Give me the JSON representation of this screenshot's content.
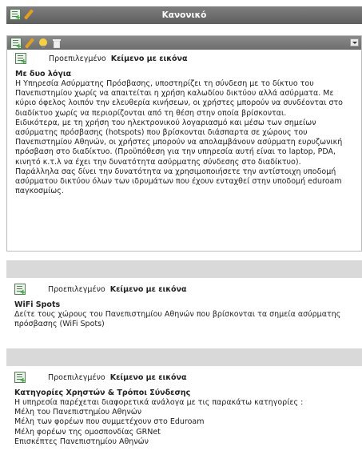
{
  "page": {
    "title": "Κανονικό"
  },
  "blocks": [
    {
      "default_label": "Προεπιλεγμένο",
      "type_name": "Κείμενο με εικόνα",
      "heading": "Με δυο λόγια",
      "paragraphs": [
        "Η Υπηρεσία Ασύρματης Πρόσβασης, υποστηρίζει τη σύνδεση με το δίκτυο του Πανεπιστημίου χωρίς να απαιτείται η χρήση καλωδίου δικτύου αλλά ασύρματα. Με κύριο όφελος λοιπόν την ελευθερία κινήσεων, οι χρήστες μπορούν να συνδέονται στο διαδίκτυο χωρίς να περιορίζονται από τη θέση στην οποία βρίσκονται.",
        "Ειδικότερα, με τη χρήση του ηλεκτρονικού λογαριασμό και μέσω των σημείων ασύρματης πρόσβασης (hotspots) που βρίσκονται διάσπαρτα σε χώρους του Πανεπιστημίου Αθηνών, οι χρήστες μπορούν να απολαμβάνουν ασύρματη ευρυζωνική πρόσβαση στο διαδίκτυο. (Προϋπόθεση για την υπηρεσία αυτή είναι το laptop, PDA, κινητό κ.τ.λ να έχει την δυνατότητα ασύρματης σύνδεσης στο διαδίκτυο).",
        "Παράλληλα σας δίνει την δυνατότητα να χρησιμοποιήσετε την αντίστοιχη υποδομή ασύρματου δικτύου όλων των ιδρυμάτων που έχουν ενταχθεί στην υποδομή eduroam παγκοσμίως."
      ]
    },
    {
      "default_label": "Προεπιλεγμένο",
      "type_name": "Κείμενο με εικόνα",
      "heading": "WiFi Spots",
      "paragraphs": [
        "Δείτε τους χώρους του Πανεπιστημίου Αθηνών που βρίσκονται τα σημεία ασύρματης πρόσβασης (WiFi Spots)"
      ]
    },
    {
      "default_label": "Προεπιλεγμένο",
      "type_name": "Κείμενο με εικόνα",
      "heading": "Κατηγορίες Χρηστών & Τρόποι Σύνδεσης",
      "paragraphs": [
        "Η υπηρεσία παρέχεται διαφορετικά ανάλογα με  τις παρακάτω κατηγορίες :",
        "Μέλη του Πανεπιστημίου Αθηνών",
        "Μέλη των φορέων που συμμετέχουν στο Eduroam",
        "Μέλη φορέων της ομοσπονδίας GRNet",
        "Επισκέπτες Πανεπιστημίου Αθηνών"
      ]
    }
  ]
}
